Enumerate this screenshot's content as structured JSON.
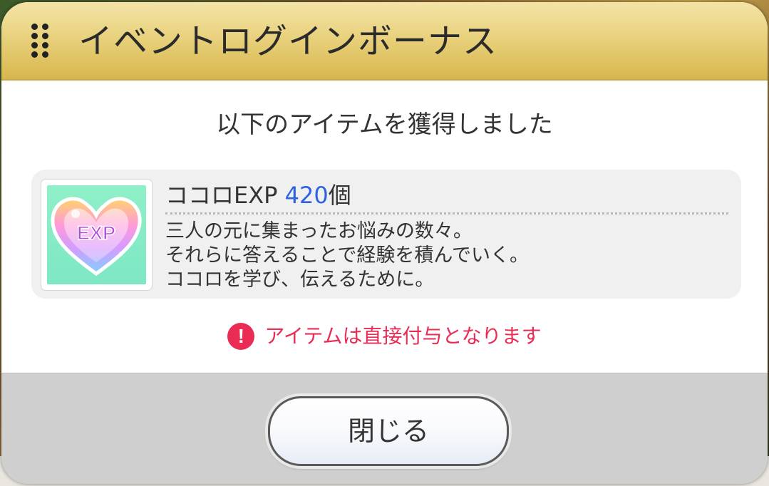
{
  "dialog": {
    "title": "イベントログインボーナス",
    "subtitle": "以下のアイテムを獲得しました",
    "item": {
      "name": "ココロEXP",
      "quantity": "420",
      "unit": "個",
      "icon_label": "EXP",
      "icon": "heart-exp-icon",
      "description": [
        "三人の元に集まったお悩みの数々。",
        "それらに答えることで経験を積んでいく。",
        "ココロを学び、伝えるために。"
      ]
    },
    "notice": {
      "icon_glyph": "!",
      "text": "アイテムは直接付与となります"
    },
    "close_label": "閉じる"
  },
  "colors": {
    "header_gold": "#e9d27e",
    "quantity_blue": "#2e62e0",
    "notice_red": "#ea2c55",
    "thumb_mint": "#8ff0c8",
    "footer_gray": "#cfcfcf"
  }
}
